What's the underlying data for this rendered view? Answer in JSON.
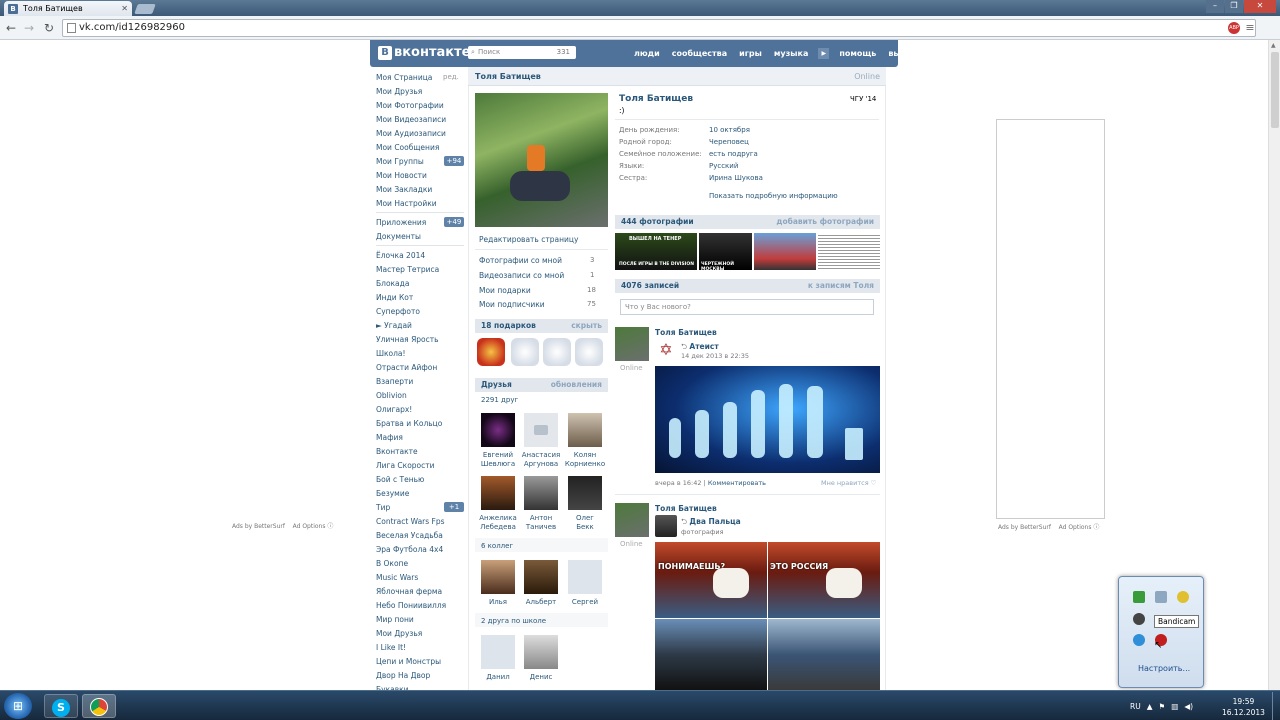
{
  "browser": {
    "tab_title": "Толя Батищев",
    "url": "vk.com/id126982960"
  },
  "header": {
    "logo_text": "вконтакте",
    "search_placeholder": "Поиск",
    "search_count": "331",
    "nav": [
      "люди",
      "сообщества",
      "игры",
      "музыка",
      "помощь",
      "выйти"
    ]
  },
  "left_nav": {
    "main": [
      {
        "label": "Моя Страница",
        "extra": "ред."
      },
      {
        "label": "Мои Друзья"
      },
      {
        "label": "Мои Фотографии"
      },
      {
        "label": "Мои Видеозаписи"
      },
      {
        "label": "Мои Аудиозаписи"
      },
      {
        "label": "Мои Сообщения"
      },
      {
        "label": "Мои Группы",
        "badge": "+94"
      },
      {
        "label": "Мои Новости"
      },
      {
        "label": "Мои Закладки"
      },
      {
        "label": "Мои Настройки"
      }
    ],
    "apps_label": "Приложения",
    "apps_badge": "+49",
    "docs_label": "Документы",
    "apps": [
      "Ёлочка 2014",
      "Мастер Тетриса",
      "Блокада",
      "Инди Кот",
      "Суперфото",
      "► Угадай",
      "Уличная Ярость",
      "Школа!",
      "Отрасти Айфон",
      "Взаперти",
      "Oblivion",
      "Олигарх!",
      "Братва и Кольцо",
      "Мафия",
      "Вконтакте",
      "Лига Скорости",
      "Бой с Тенью",
      "Безумие",
      "Тир",
      "Contract Wars Fps",
      "Веселая Усадьба",
      "Эра Футбола 4х4",
      "В Окопе",
      "Music Wars",
      "Яблочная ферма",
      "Небо Пониивилля",
      "Мир пони",
      "Мои Друзья",
      "I Like It!",
      "Цепи и Монстры",
      "Двор На Двор",
      "Букавки"
    ],
    "tir_badge": "+1"
  },
  "profile": {
    "name": "Толя Батищев",
    "online": "Online",
    "status": ":)",
    "school": "ЧГУ '14",
    "edit_page": "Редактировать страницу",
    "info": [
      {
        "label": "День рождения:",
        "value": "10 октября"
      },
      {
        "label": "Родной город:",
        "value": "Череповец"
      },
      {
        "label": "Семейное положение:",
        "value": "есть подруга"
      },
      {
        "label": "Языки:",
        "value": "Русский"
      },
      {
        "label": "Сестра:",
        "value": "Ирина Шукова"
      }
    ],
    "show_more": "Показать подробную информацию",
    "counters": [
      {
        "label": "Фотографии со мной",
        "value": "3"
      },
      {
        "label": "Видеозаписи со мной",
        "value": "1"
      },
      {
        "label": "Мои подарки",
        "value": "18"
      },
      {
        "label": "Мои подписчики",
        "value": "75"
      }
    ]
  },
  "gifts": {
    "title": "18 подарков",
    "action": "скрыть"
  },
  "friends": {
    "title": "Друзья",
    "action": "обновления",
    "count": "2291 друг",
    "list": [
      {
        "first": "Евгений",
        "last": "Шевлюга"
      },
      {
        "first": "Анастасия",
        "last": "Аргунова"
      },
      {
        "first": "Колян",
        "last": "Корниенко"
      },
      {
        "first": "Анжелика",
        "last": "Лебедева"
      },
      {
        "first": "Антон",
        "last": "Таничев"
      },
      {
        "first": "Олег",
        "last": "Бекк"
      }
    ],
    "colleagues_label": "6 коллег",
    "colleagues": [
      "Илья",
      "Альберт",
      "Сергей"
    ],
    "school_label": "2 друга по школе",
    "school": [
      "Данил",
      "Денис"
    ]
  },
  "photos": {
    "title": "444 фотографии",
    "action": "добавить фотографии",
    "captions": [
      "ВЫШЕЛ НА ТЕНЕР",
      "ПОСЛЕ ИГРЫ В THE DIVISION",
      "ЧЕРТЕЖНОЙ МОСКВЫ"
    ]
  },
  "wall": {
    "title": "4076 записей",
    "action": "к записям Толя",
    "placeholder": "Что у Вас нового?",
    "posts": [
      {
        "author": "Толя Батищев",
        "online": "Online",
        "repost": "Атеист",
        "date": "14 дек 2013 в 22:35",
        "time": "вчера в 16:42",
        "comment": "Комментировать",
        "like": "Мне нравится"
      },
      {
        "author": "Толя Батищев",
        "online": "Online",
        "repost": "Два Пальца",
        "sub": "фотография",
        "memes": [
          "ПОНИМАЕШЬ?",
          "ЭТО РОССИЯ"
        ]
      }
    ]
  },
  "ads": {
    "left": "Ads by BetterSurf",
    "options": "Ad Options",
    "right": "Ads by BetterSurf"
  },
  "taskbar": {
    "lang": "RU",
    "time": "19:59",
    "date": "16.12.2013",
    "tooltip": "Bandicam",
    "configure": "Настроить..."
  }
}
